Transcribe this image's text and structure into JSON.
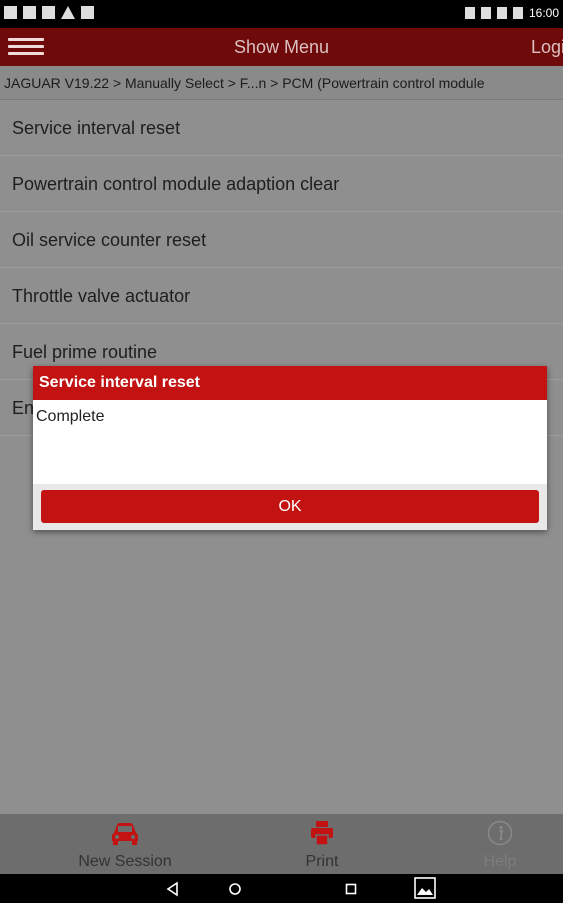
{
  "status_bar": {
    "time": "16:00"
  },
  "app_bar": {
    "title": "Show Menu",
    "login_label": "Logi"
  },
  "breadcrumb": "JAGUAR V19.22 > Manually Select > F...n > PCM (Powertrain control module",
  "menu_items": [
    "Service interval reset",
    "Powertrain control module adaption clear",
    "Oil service counter reset",
    "Throttle valve actuator",
    "Fuel prime routine",
    "En"
  ],
  "dialog": {
    "title": "Service interval reset",
    "message": "Complete",
    "ok_label": "OK"
  },
  "bottom_bar": {
    "new_session": "New Session",
    "print": "Print",
    "help": "Help"
  },
  "colors": {
    "app_bar": "#6e0a0a",
    "dialog_accent": "#c21212",
    "icon_red": "#c21212"
  }
}
